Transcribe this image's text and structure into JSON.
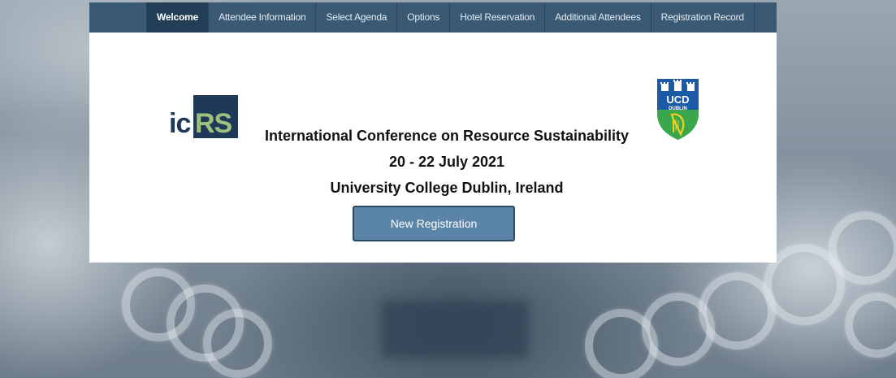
{
  "nav": {
    "tabs": [
      {
        "label": "Welcome",
        "active": true
      },
      {
        "label": "Attendee Information",
        "active": false
      },
      {
        "label": "Select Agenda",
        "active": false
      },
      {
        "label": "Options",
        "active": false
      },
      {
        "label": "Hotel Reservation",
        "active": false
      },
      {
        "label": "Additional Attendees",
        "active": false
      },
      {
        "label": "Registration Record",
        "active": false
      }
    ]
  },
  "logos": {
    "left": {
      "text_dark": "ic",
      "text_light": "RS"
    },
    "right": {
      "text_main": "UCD",
      "text_sub": "DUBLIN"
    }
  },
  "welcome": {
    "conference_name": "International Conference on Resource Sustainability",
    "dates": "20 - 22 July 2021",
    "venue": "University College Dublin, Ireland",
    "new_registration_label": "New Registration"
  },
  "colors": {
    "nav_bg": "#3a5a74",
    "nav_active": "#213e56",
    "button_bg": "#5a84a8",
    "icrs_navy": "#1f3a58",
    "icrs_green": "#9fc07e"
  }
}
